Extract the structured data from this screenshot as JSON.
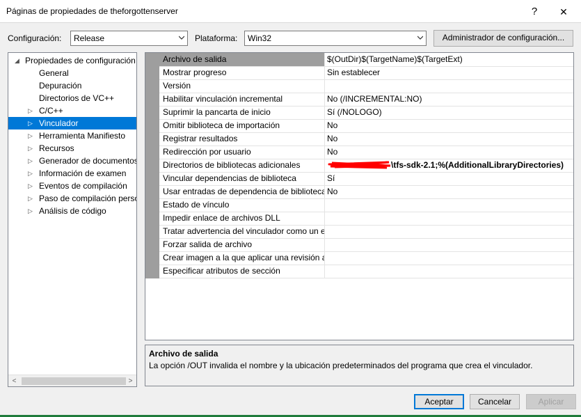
{
  "window": {
    "title": "Páginas de propiedades de theforgottenserver",
    "help": "?",
    "close": "✕"
  },
  "toolbar": {
    "config_label": "Configuración:",
    "config_value": "Release",
    "platform_label": "Plataforma:",
    "platform_value": "Win32",
    "manager_button": "Administrador de configuración..."
  },
  "tree": {
    "root": "Propiedades de configuración",
    "items": [
      {
        "label": "General"
      },
      {
        "label": "Depuración"
      },
      {
        "label": "Directorios de VC++"
      },
      {
        "label": "C/C++"
      },
      {
        "label": "Vinculador"
      },
      {
        "label": "Herramienta Manifiesto"
      },
      {
        "label": "Recursos"
      },
      {
        "label": "Generador de documentos XML"
      },
      {
        "label": "Información de examen"
      },
      {
        "label": "Eventos de compilación"
      },
      {
        "label": "Paso de compilación personalizado"
      },
      {
        "label": "Análisis de código"
      }
    ]
  },
  "grid": {
    "rows": [
      {
        "name": "Archivo de salida",
        "value": "$(OutDir)$(TargetName)$(TargetExt)"
      },
      {
        "name": "Mostrar progreso",
        "value": "Sin establecer"
      },
      {
        "name": "Versión",
        "value": ""
      },
      {
        "name": "Habilitar vinculación incremental",
        "value": "No (/INCREMENTAL:NO)"
      },
      {
        "name": "Suprimir la pancarta de inicio",
        "value": "Sí (/NOLOGO)"
      },
      {
        "name": "Omitir biblioteca de importación",
        "value": "No"
      },
      {
        "name": "Registrar resultados",
        "value": "No"
      },
      {
        "name": "Redirección por usuario",
        "value": "No"
      },
      {
        "name": "Directorios de bibliotecas adicionales",
        "value": "\\tfs-sdk-2.1;%(AdditionalLibraryDirectories)"
      },
      {
        "name": "Vincular dependencias de biblioteca",
        "value": "Sí"
      },
      {
        "name": "Usar entradas de dependencia de biblioteca",
        "value": "No"
      },
      {
        "name": "Estado de vínculo",
        "value": ""
      },
      {
        "name": "Impedir enlace de archivos DLL",
        "value": ""
      },
      {
        "name": "Tratar advertencia del vinculador como un error",
        "value": ""
      },
      {
        "name": "Forzar salida de archivo",
        "value": ""
      },
      {
        "name": "Crear imagen a la que aplicar una revisión activa",
        "value": ""
      },
      {
        "name": "Especificar atributos de sección",
        "value": ""
      }
    ]
  },
  "description": {
    "title": "Archivo de salida",
    "body": "La opción /OUT invalida el nombre y la ubicación predeterminados del programa que crea el vinculador."
  },
  "buttons": {
    "ok": "Aceptar",
    "cancel": "Cancelar",
    "apply": "Aplicar"
  },
  "colors": {
    "accent": "#0078d7",
    "selected_row": "#9e9e9e",
    "redaction": "#ff0000"
  }
}
